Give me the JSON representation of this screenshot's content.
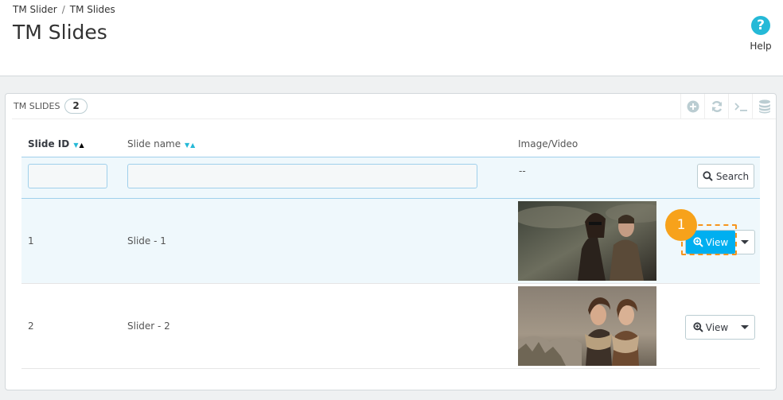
{
  "breadcrumb": {
    "parent": "TM Slider",
    "separator": "/",
    "current": "TM Slides"
  },
  "page_title": "TM Slides",
  "help": {
    "label": "Help",
    "glyph": "?"
  },
  "panel": {
    "title": "TM SLIDES",
    "count": "2",
    "toolbar_icons": [
      "add-circle-icon",
      "refresh-icon",
      "terminal-icon",
      "database-icon"
    ]
  },
  "table": {
    "columns": {
      "id": "Slide ID",
      "name": "Slide name",
      "media": "Image/Video"
    },
    "filter": {
      "id_value": "",
      "name_value": "",
      "media_placeholder": "--",
      "search_label": "Search"
    },
    "rows": [
      {
        "id": "1",
        "name": "Slide - 1",
        "action": "View"
      },
      {
        "id": "2",
        "name": "Slider - 2",
        "action": "View"
      }
    ]
  },
  "callout": {
    "number": "1",
    "color": "#f7941d"
  },
  "colors": {
    "accent": "#25b9d7",
    "active_button": "#00aff0",
    "highlight_row": "#eff8fc"
  }
}
